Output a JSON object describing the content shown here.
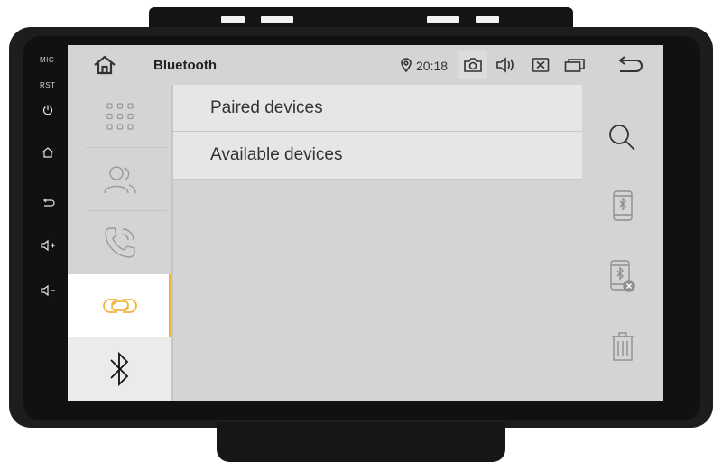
{
  "hardware": {
    "mic_label": "MIC",
    "rst_label": "RST",
    "buttons": [
      "power-icon",
      "home-icon",
      "back-icon",
      "volume-up-icon",
      "volume-down-icon"
    ]
  },
  "statusbar": {
    "title": "Bluetooth",
    "time": "20:18",
    "icons": [
      "home-icon",
      "location-icon",
      "camera-icon",
      "volume-icon",
      "close-box-icon",
      "windows-icon",
      "back-icon"
    ]
  },
  "nav": {
    "items": [
      {
        "name": "apps-grid-icon",
        "active": false
      },
      {
        "name": "contacts-icon",
        "active": false
      },
      {
        "name": "phone-call-icon",
        "active": false
      },
      {
        "name": "link-icon",
        "active": true
      },
      {
        "name": "bluetooth-icon",
        "active": false
      }
    ],
    "accent_color": "#f0b43c"
  },
  "list": {
    "items": [
      "Paired devices",
      "Available devices"
    ]
  },
  "actions": [
    "search-icon",
    "bluetooth-phone-icon",
    "bluetooth-phone-disconnect-icon",
    "trash-icon"
  ]
}
